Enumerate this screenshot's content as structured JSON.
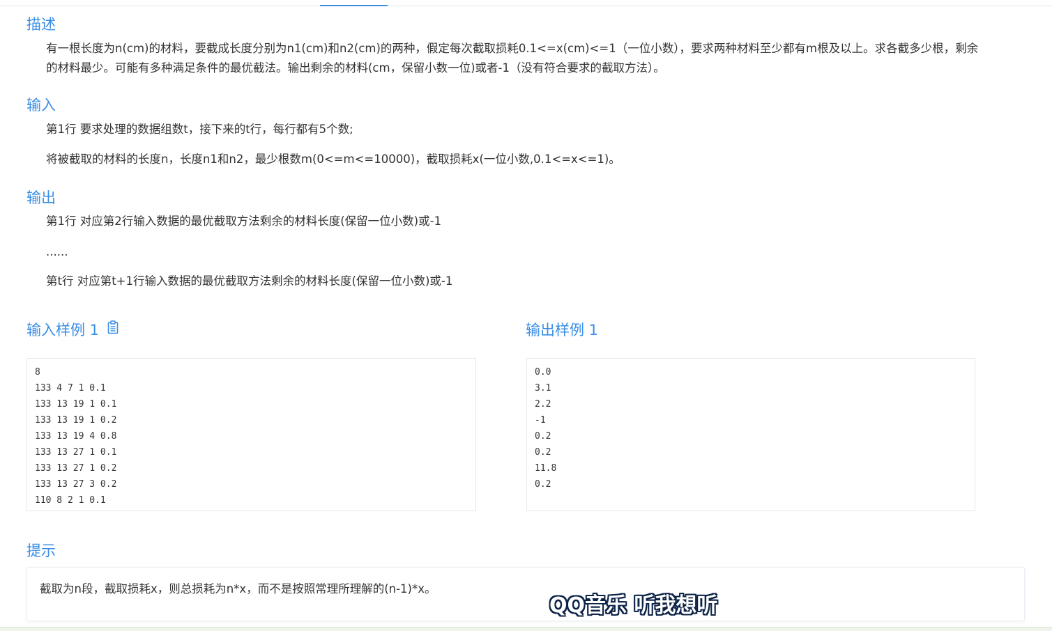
{
  "description": {
    "title": "描述",
    "line1": "有一根长度为n(cm)的材料，要截成长度分别为n1(cm)和n2(cm)的两种，假定每次截取损耗0.1<=x(cm)<=1（一位小数），要求两种材料至少都有m根及以上。求各截多少根，剩余",
    "line2": "的材料最少。可能有多种满足条件的最优截法。输出剩余的材料(cm，保留小数一位)或者-1（没有符合要求的截取方法）。"
  },
  "input": {
    "title": "输入",
    "line1": "第1行 要求处理的数据组数t，接下来的t行，每行都有5个数;",
    "line2": "将被截取的材料的长度n，长度n1和n2，最少根数m(0<=m<=10000)，截取损耗x(一位小数,0.1<=x<=1)。"
  },
  "output": {
    "title": "输出",
    "line1": "第1行 对应第2行输入数据的最优截取方法剩余的材料长度(保留一位小数)或-1",
    "line2": "......",
    "line3": "第t行 对应第t+1行输入数据的最优截取方法剩余的材料长度(保留一位小数)或-1"
  },
  "sample_input": {
    "title": "输入样例 1",
    "copy_icon": "clipboard-icon",
    "lines": [
      "8",
      "133 4 7 1 0.1",
      "133 13 19 1 0.1",
      "133 13 19 1 0.2",
      "133 13 19 4 0.8",
      "133 13 27 1 0.1",
      "133 13 27 1 0.2",
      "133 13 27 3 0.2",
      "110 8 2 1 0.1"
    ]
  },
  "sample_output": {
    "title": "输出样例 1",
    "lines": [
      "0.0",
      "3.1",
      "2.2",
      "-1",
      "0.2",
      "0.2",
      "11.8",
      "0.2"
    ]
  },
  "hint": {
    "title": "提示",
    "text": "截取为n段，截取损耗x，则总损耗为n*x，而不是按照常理所理解的(n-1)*x。"
  },
  "watermark": {
    "text": "QQ音乐 听我想听"
  },
  "colors": {
    "accent": "#3a8ee6",
    "text": "#333333",
    "border": "#e4e7ed"
  }
}
